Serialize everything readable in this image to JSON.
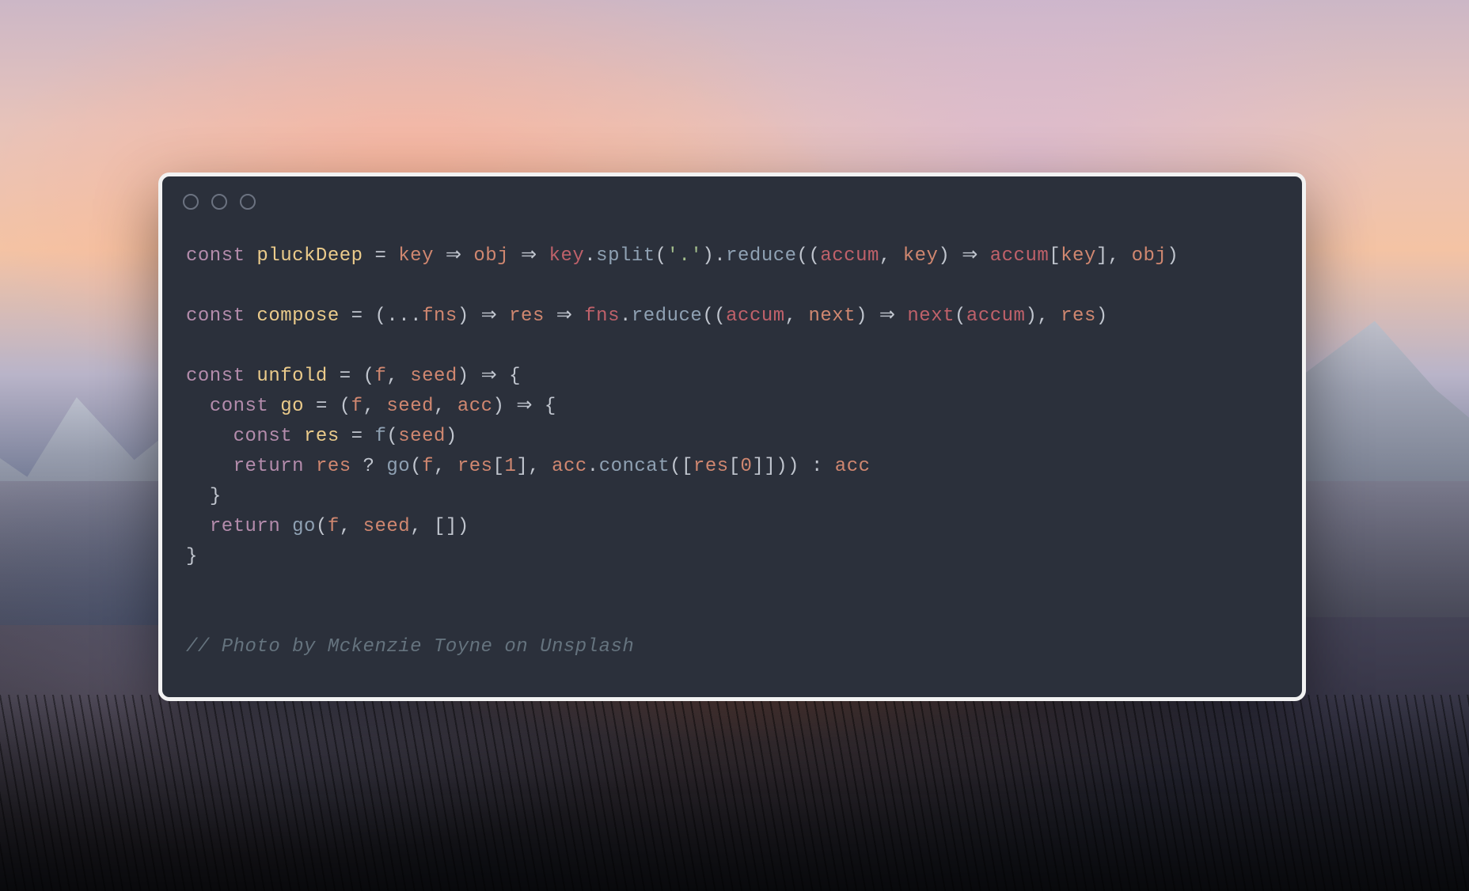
{
  "background": {
    "credit_comment": "// Photo by Mckenzie Toyne on Unsplash"
  },
  "window": {
    "traffic_light_count": 3
  },
  "code": {
    "line1": {
      "kw_const": "const",
      "name": "pluckDeep",
      "eq": " = ",
      "p_key": "key",
      "arrow1": " ⇒ ",
      "p_obj": "obj",
      "arrow2": " ⇒ ",
      "key2": "key",
      "dot1": ".",
      "split": "split",
      "lp1": "(",
      "str_dot": "'.'",
      "rp1": ")",
      "dot2": ".",
      "reduce": "reduce",
      "lp2": "((",
      "accum": "accum",
      "comma1": ", ",
      "key3": "key",
      "rp2": ")",
      "arrow3": " ⇒ ",
      "accum2": "accum",
      "lb": "[",
      "key4": "key",
      "rb": "]",
      "comma2": ", ",
      "obj2": "obj",
      "rp3": ")"
    },
    "line2": {
      "kw_const": "const",
      "name": "compose",
      "eq": " = ",
      "lp1": "(",
      "spread": "...",
      "fns": "fns",
      "rp1": ")",
      "arrow1": " ⇒ ",
      "res": "res",
      "arrow2": " ⇒ ",
      "fns2": "fns",
      "dot": ".",
      "reduce": "reduce",
      "lp2": "((",
      "accum": "accum",
      "comma1": ", ",
      "next": "next",
      "rp2": ")",
      "arrow3": " ⇒ ",
      "next2": "next",
      "lp3": "(",
      "accum2": "accum",
      "rp3": ")",
      "comma2": ", ",
      "res2": "res",
      "rp4": ")"
    },
    "line3": {
      "kw_const": "const",
      "name": "unfold",
      "eq": " = ",
      "lp": "(",
      "f": "f",
      "comma": ", ",
      "seed": "seed",
      "rp": ")",
      "arrow": " ⇒ ",
      "brace": "{"
    },
    "line4": {
      "indent": "  ",
      "kw_const": "const",
      "name": "go",
      "eq": " = ",
      "lp": "(",
      "f": "f",
      "c1": ", ",
      "seed": "seed",
      "c2": ", ",
      "acc": "acc",
      "rp": ")",
      "arrow": " ⇒ ",
      "brace": "{"
    },
    "line5": {
      "indent": "    ",
      "kw_const": "const",
      "name": "res",
      "eq": " = ",
      "f": "f",
      "lp": "(",
      "seed": "seed",
      "rp": ")"
    },
    "line6": {
      "indent": "    ",
      "kw_return": "return",
      "sp": " ",
      "res": "res",
      "q": " ? ",
      "go": "go",
      "lp": "(",
      "f": "f",
      "c1": ", ",
      "res2": "res",
      "lb1": "[",
      "one": "1",
      "rb1": "]",
      "c2": ", ",
      "acc": "acc",
      "dot": ".",
      "concat": "concat",
      "lp2": "([",
      "res3": "res",
      "lb2": "[",
      "zero": "0",
      "rb2": "]",
      "rp2": "]))",
      "colon": " : ",
      "acc2": "acc"
    },
    "line7": {
      "indent": "  ",
      "brace": "}"
    },
    "line8": {
      "indent": "  ",
      "kw_return": "return",
      "sp": " ",
      "go": "go",
      "lp": "(",
      "f": "f",
      "c1": ", ",
      "seed": "seed",
      "c2": ", ",
      "arr": "[]",
      "rp": ")"
    },
    "line9": {
      "brace": "}"
    }
  }
}
